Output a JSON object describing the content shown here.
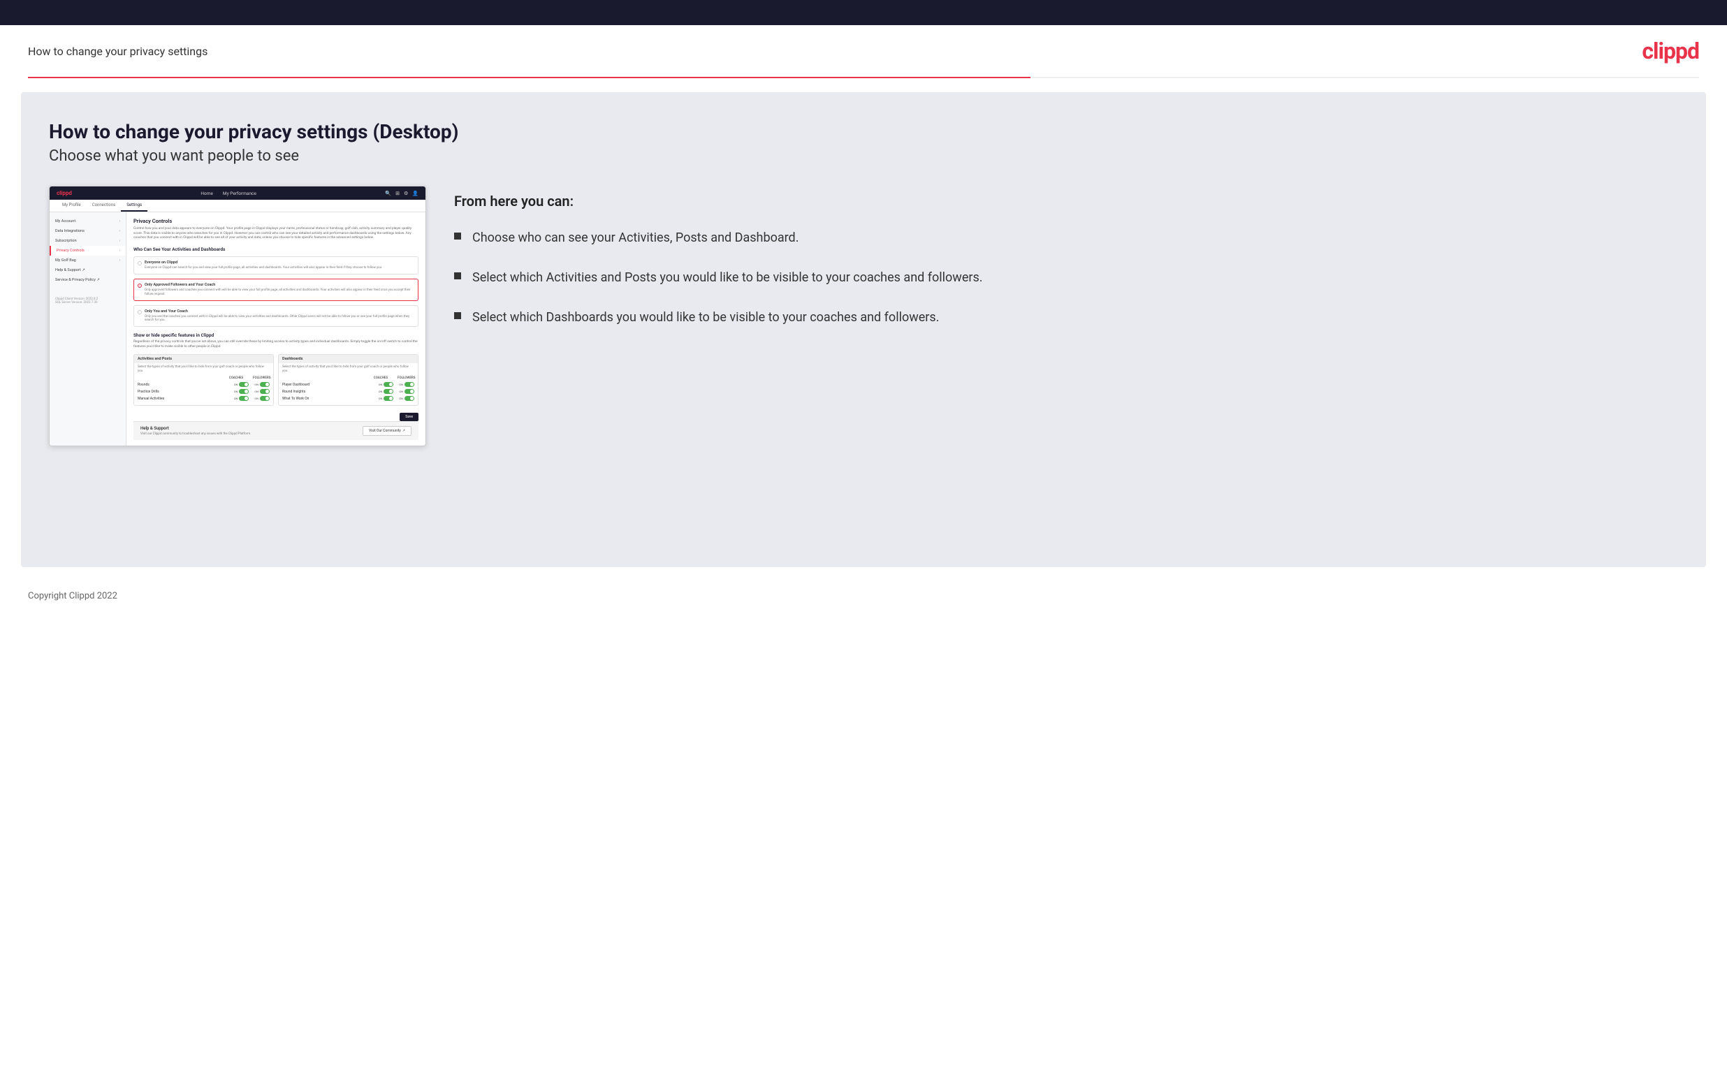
{
  "header": {
    "title": "How to change your privacy settings",
    "logo": "clippd"
  },
  "main": {
    "heading": "How to change your privacy settings (Desktop)",
    "subheading": "Choose what you want people to see",
    "right_panel": {
      "from_here_label": "From here you can:",
      "bullets": [
        "Choose who can see your Activities, Posts and Dashboard.",
        "Select which Activities and Posts you would like to be visible to your coaches and followers.",
        "Select which Dashboards you would like to be visible to your coaches and followers."
      ]
    }
  },
  "app_screenshot": {
    "nav": {
      "logo": "clippd",
      "links": [
        "Home",
        "My Performance"
      ],
      "icons": [
        "search",
        "grid",
        "settings",
        "user"
      ]
    },
    "tabs": [
      "My Profile",
      "Connections",
      "Settings"
    ],
    "active_tab": "Settings",
    "sidebar": {
      "items": [
        {
          "label": "My Account",
          "active": false
        },
        {
          "label": "Data Integrations",
          "active": false
        },
        {
          "label": "Subscription",
          "active": false
        },
        {
          "label": "Privacy Controls",
          "active": true
        },
        {
          "label": "My Golf Bag",
          "active": false
        },
        {
          "label": "Help & Support",
          "active": false
        },
        {
          "label": "Service & Privacy Policy",
          "active": false
        }
      ],
      "version": "Clippd Client Version: 2022.8.2\nSQL Server Version: 2022.7.30"
    },
    "privacy_controls": {
      "title": "Privacy Controls",
      "description": "Control how you and your data appears to everyone on Clippd. Your profile page in Clippd displays your name, professional status or handicap, golf club, activity summary and player quality score. This data is visible to anyone who searches for you in Clippd. However you can control who can see your detailed activity and performance dashboards using the settings below. Any coaches that you connect with in Clippd will be able to see all of your activity and data, unless you choose to hide specific features in the advanced settings below.",
      "who_can_see_title": "Who Can See Your Activities and Dashboards",
      "options": [
        {
          "id": "everyone",
          "label": "Everyone on Clippd",
          "description": "Everyone on Clippd can search for you and view your full profile page, all activities and dashboards. Your activities will also appear in their feed if they choose to follow you.",
          "selected": false
        },
        {
          "id": "followers",
          "label": "Only Approved Followers and Your Coach",
          "description": "Only approved followers and coaches you connect with will be able to view your full profile page, all activities and dashboards. Your activities will also appear in their feed once you accept their follow request.",
          "selected": true
        },
        {
          "id": "coach_only",
          "label": "Only You and Your Coach",
          "description": "Only you and the coaches you connect with in Clippd will be able to view your activities and dashboards. Other Clippd users will not be able to follow you or see your full profile page when they search for you.",
          "selected": false
        }
      ]
    },
    "show_hide": {
      "title": "Show or hide specific features in Clippd",
      "description": "Regardless of the privacy controls that you've set above, you can still override these by limiting access to activity types and individual dashboards. Simply toggle the on/off switch to control the features you'd like to make visible to other people in Clippd.",
      "activities_posts": {
        "header": "Activities and Posts",
        "description": "Select the types of activity that you'd like to hide from your golf coach or people who follow you.",
        "columns": [
          "COACHES",
          "FOLLOWERS"
        ],
        "rows": [
          {
            "name": "Rounds",
            "coaches_on": true,
            "followers_on": true
          },
          {
            "name": "Practice Drills",
            "coaches_on": true,
            "followers_on": true
          },
          {
            "name": "Manual Activities",
            "coaches_on": true,
            "followers_on": true
          }
        ]
      },
      "dashboards": {
        "header": "Dashboards",
        "description": "Select the types of activity that you'd like to hide from your golf coach or people who follow you.",
        "columns": [
          "COACHES",
          "FOLLOWERS"
        ],
        "rows": [
          {
            "name": "Player Dashboard",
            "coaches_on": true,
            "followers_on": true
          },
          {
            "name": "Round Insights",
            "coaches_on": true,
            "followers_on": true
          },
          {
            "name": "What To Work On",
            "coaches_on": true,
            "followers_on": true
          }
        ]
      }
    },
    "save_button": "Save",
    "help": {
      "title": "Help & Support",
      "description": "Visit our Clippd community to troubleshoot any issues with the Clippd Platform.",
      "button": "Visit Our Community"
    }
  },
  "sidebar_account_label": "Account",
  "footer": {
    "copyright": "Copyright Clippd 2022"
  }
}
